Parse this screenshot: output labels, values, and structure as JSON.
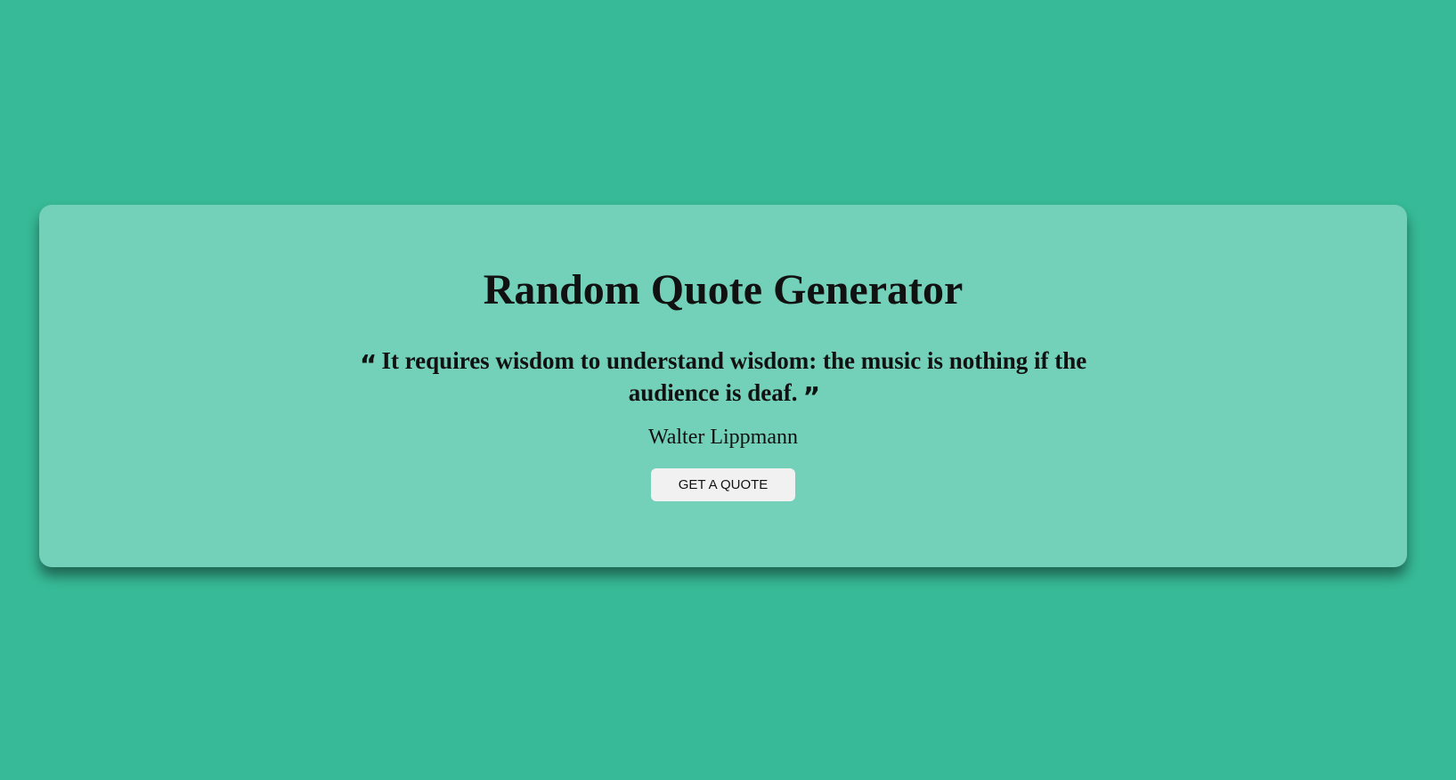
{
  "app": {
    "title": "Random Quote Generator"
  },
  "quote": {
    "text": "It requires wisdom to understand wisdom: the music is nothing if the audience is deaf.",
    "author": "Walter Lippmann",
    "open_icon": "quote-left-icon",
    "close_icon": "quote-right-icon"
  },
  "actions": {
    "get_quote_label": "GET A QUOTE"
  },
  "colors": {
    "page_background": "#37ba97",
    "card_background": "#73d0b9",
    "button_background": "#f1f1f1",
    "text": "#111111"
  }
}
